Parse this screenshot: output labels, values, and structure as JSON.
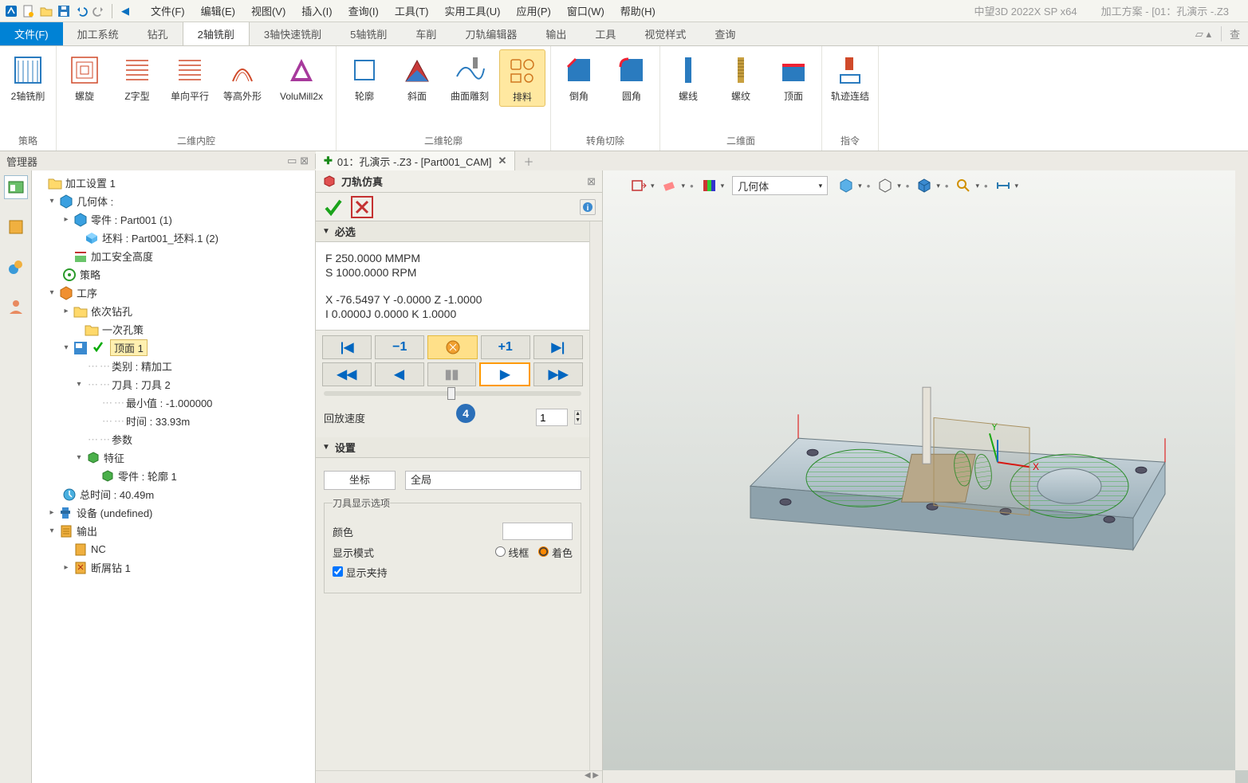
{
  "titlebar": {
    "app_name": "中望3D 2022X SP x64",
    "scheme_label": "加工方案",
    "doc_name": "[01：孔演示 -.Z3"
  },
  "menu": {
    "file": "文件(F)",
    "edit": "编辑(E)",
    "view": "视图(V)",
    "insert": "插入(I)",
    "query": "查询(I)",
    "tools": "工具(T)",
    "util": "实用工具(U)",
    "app": "应用(P)",
    "window": "窗口(W)",
    "help": "帮助(H)"
  },
  "ribbon": {
    "tabs": {
      "file": "文件(F)",
      "sys": "加工系统",
      "drill": "钻孔",
      "mill2": "2轴铣削",
      "mill3": "3轴快速铣削",
      "mill5": "5轴铣削",
      "lathe": "车削",
      "editor": "刀轨编辑器",
      "output": "输出",
      "tools": "工具",
      "visual": "视觉样式",
      "query": "查询"
    },
    "groups": {
      "strategy": "策略",
      "pocket": "二维内腔",
      "contour": "二维轮廓",
      "corner": "转角切除",
      "plane": "二维面",
      "cmd": "指令"
    },
    "btns": {
      "mill2ax": "2轴铣削",
      "spiral": "螺旋",
      "zshape": "Z字型",
      "oneway": "单向平行",
      "highcontour": "等高外形",
      "volumill": "VoluMill2x",
      "profile": "轮廓",
      "bevel": "斜面",
      "engrave": "曲面雕刻",
      "nest": "排料",
      "chamfer": "倒角",
      "fillet": "圆角",
      "helix": "螺线",
      "thread": "螺纹",
      "topface": "顶面",
      "link": "轨迹连结"
    }
  },
  "doc_strip": {
    "manager": "管理器",
    "tab_title": "01：孔演示 -.Z3 - [Part001_CAM]"
  },
  "tree": {
    "root": "加工设置 1",
    "geom": "几何体 :",
    "part": "零件 : Part001 (1)",
    "stock": "坯料 : Part001_坯料.1 (2)",
    "safe": "加工安全高度",
    "strategy": "策略",
    "ops": "工序",
    "drillseq": "依次钻孔",
    "drillonce": "一次孔策",
    "topface": "顶面 1",
    "class_label": "类别 :",
    "class_val": "精加工",
    "tool_label": "刀具 :",
    "tool_val": "刀具 2",
    "min_label": "最小值 :",
    "min_val": "-1.000000",
    "time_label": "时间 :",
    "time_val": "33.93m",
    "params": "参数",
    "feature": "特征",
    "featpart": "零件 : 轮廓 1",
    "total_label": "总时间 :",
    "total_val": "40.49m",
    "device": "设备 (undefined)",
    "output": "输出",
    "nc": "NC",
    "chip": "断屑钻 1"
  },
  "sim": {
    "title": "刀轨仿真",
    "section_required": "必选",
    "feed": "F  250.0000 MMPM",
    "speed": "S 1000.0000 RPM",
    "xyz": "X  -76.5497          Y   -0.0000           Z  -1.0000",
    "ijk": "I    0.0000J    0.0000              K   1.0000",
    "minus1": "−1",
    "plus1": "+1",
    "speed_label": "回放速度",
    "speed_value": "1",
    "section_settings": "设置",
    "coord_label": "坐标",
    "coord_value": "全局",
    "tool_display": "刀具显示选项",
    "color_label": "颜色",
    "mode_label": "显示模式",
    "mode_wire": "线框",
    "mode_shade": "着色",
    "show_holder": "显示夹持"
  },
  "viewport": {
    "geom_select": "几何体"
  },
  "callout": {
    "num4": "4"
  }
}
